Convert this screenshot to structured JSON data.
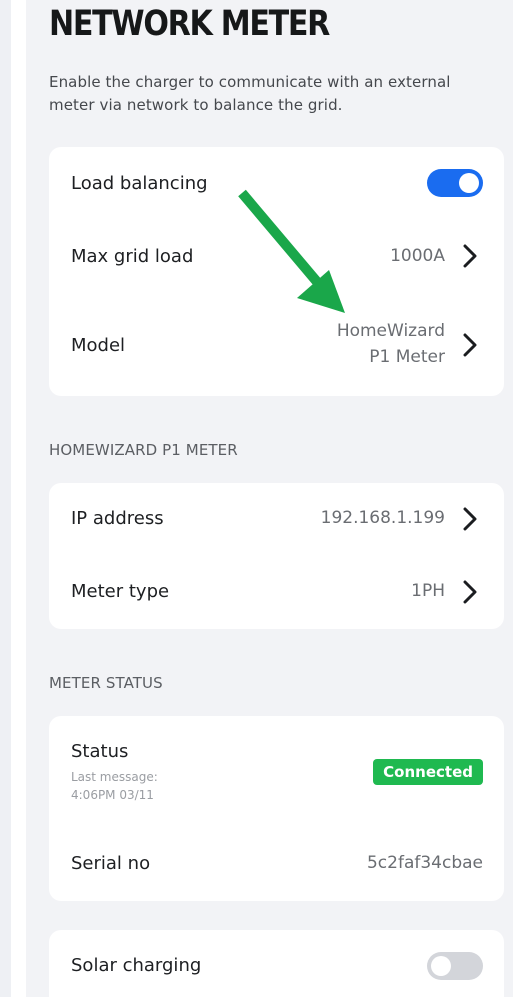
{
  "page": {
    "title": "NETWORK METER",
    "description": "Enable the charger to communicate with an external meter via network to balance the grid."
  },
  "network_card": {
    "load_balancing": {
      "label": "Load balancing",
      "enabled": true
    },
    "max_grid_load": {
      "label": "Max grid load",
      "value": "1000A"
    },
    "model": {
      "label": "Model",
      "value_line1": "HomeWizard",
      "value_line2": "P1 Meter"
    }
  },
  "homewizard_section": {
    "header": "HOMEWIZARD P1 METER",
    "ip_address": {
      "label": "IP address",
      "value": "192.168.1.199"
    },
    "meter_type": {
      "label": "Meter type",
      "value": "1PH"
    }
  },
  "meter_status_section": {
    "header": "METER STATUS",
    "status": {
      "label": "Status",
      "last_message_label": "Last message:",
      "last_message_time": "4:06PM 03/11",
      "badge": "Connected"
    },
    "serial": {
      "label": "Serial no",
      "value": "5c2faf34cbae"
    }
  },
  "solar_card": {
    "solar_charging": {
      "label": "Solar charging",
      "enabled": false
    }
  },
  "colors": {
    "toggle_on": "#1a6cf0",
    "toggle_off": "#d3d5da",
    "status_connected": "#1fb950",
    "annotation_arrow": "#1aa74a"
  },
  "icons": {
    "chevron": "chevron-right-icon",
    "annotation": "green-arrow-icon"
  }
}
